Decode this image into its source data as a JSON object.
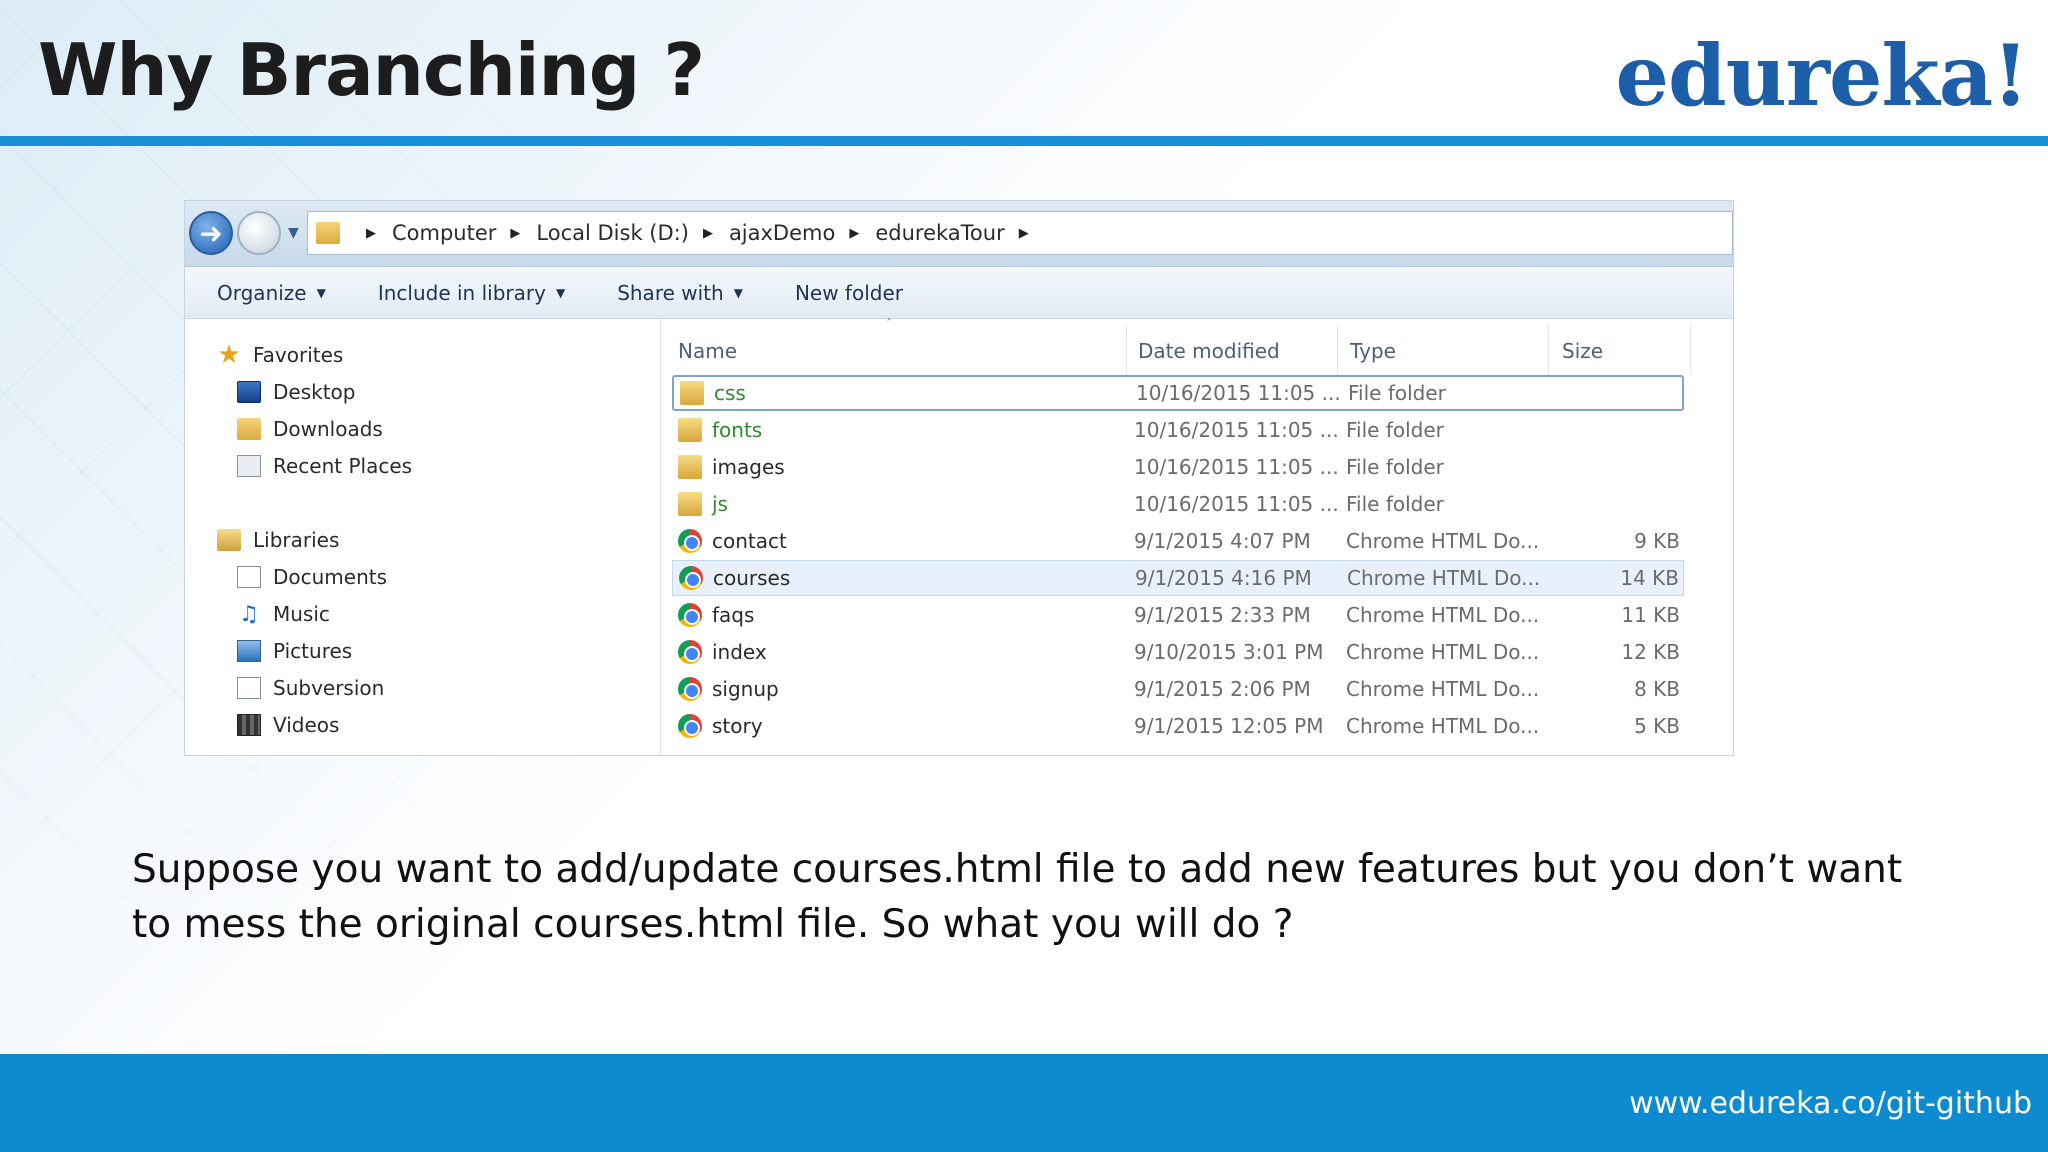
{
  "slide": {
    "title": "Why Branching ?",
    "brand": "edureka!",
    "caption": "Suppose you want to add/update courses.html file to add new features but you don’t want to mess the original courses.html file. So what you will do ?",
    "footer_url": "www.edureka.co/git-github"
  },
  "explorer": {
    "breadcrumbs": [
      "Computer",
      "Local Disk (D:)",
      "ajaxDemo",
      "edurekaTour"
    ],
    "toolbar": [
      {
        "label": "Organize",
        "has_menu": true
      },
      {
        "label": "Include in library",
        "has_menu": true
      },
      {
        "label": "Share with",
        "has_menu": true
      },
      {
        "label": "New folder",
        "has_menu": false
      }
    ],
    "nav": [
      {
        "label": "Favorites",
        "icon": "star-icon"
      },
      {
        "label": "Desktop",
        "icon": "desktop-icon"
      },
      {
        "label": "Downloads",
        "icon": "downloads-folder-icon"
      },
      {
        "label": "Recent Places",
        "icon": "recent-places-icon"
      },
      {
        "label": "Libraries",
        "icon": "libraries-icon"
      },
      {
        "label": "Documents",
        "icon": "documents-icon"
      },
      {
        "label": "Music",
        "icon": "music-icon"
      },
      {
        "label": "Pictures",
        "icon": "pictures-icon"
      },
      {
        "label": "Subversion",
        "icon": "subversion-icon"
      },
      {
        "label": "Videos",
        "icon": "videos-icon"
      }
    ],
    "columns": {
      "name": "Name",
      "date": "Date modified",
      "type": "Type",
      "size": "Size"
    },
    "files": [
      {
        "name": "css",
        "date": "10/16/2015 11:05 ...",
        "type": "File folder",
        "size": "",
        "kind": "folder"
      },
      {
        "name": "fonts",
        "date": "10/16/2015 11:05 ...",
        "type": "File folder",
        "size": "",
        "kind": "folder"
      },
      {
        "name": "images",
        "date": "10/16/2015 11:05 ...",
        "type": "File folder",
        "size": "",
        "kind": "folder"
      },
      {
        "name": "js",
        "date": "10/16/2015 11:05 ...",
        "type": "File folder",
        "size": "",
        "kind": "folder"
      },
      {
        "name": "contact",
        "date": "9/1/2015 4:07 PM",
        "type": "Chrome HTML Do...",
        "size": "9 KB",
        "kind": "chrome"
      },
      {
        "name": "courses",
        "date": "9/1/2015 4:16 PM",
        "type": "Chrome HTML Do...",
        "size": "14 KB",
        "kind": "chrome"
      },
      {
        "name": "faqs",
        "date": "9/1/2015 2:33 PM",
        "type": "Chrome HTML Do...",
        "size": "11 KB",
        "kind": "chrome"
      },
      {
        "name": "index",
        "date": "9/10/2015 3:01 PM",
        "type": "Chrome HTML Do...",
        "size": "12 KB",
        "kind": "chrome"
      },
      {
        "name": "signup",
        "date": "9/1/2015 2:06 PM",
        "type": "Chrome HTML Do...",
        "size": "8 KB",
        "kind": "chrome"
      },
      {
        "name": "story",
        "date": "9/1/2015 12:05 PM",
        "type": "Chrome HTML Do...",
        "size": "5 KB",
        "kind": "chrome"
      }
    ]
  },
  "colors": {
    "accent_blue": "#1a8fd6",
    "brand_blue": "#1d5ea8",
    "footer_blue": "#0d8bd1"
  }
}
